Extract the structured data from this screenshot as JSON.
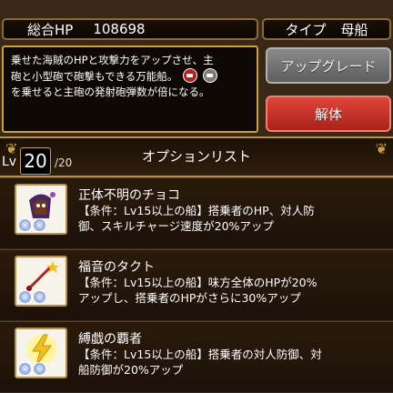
{
  "stats": {
    "hp_label": "総合HP",
    "hp_value": "108698",
    "type_label": "タイプ",
    "type_value": "母船"
  },
  "description": {
    "line1": "乗せた海賊のHPと攻撃力をアップさせ、主",
    "line2": "砲と小型砲で砲撃もできる万能船。",
    "line3": "を乗せると主砲の発射砲弾数が倍になる。",
    "icons": [
      "cannon-icon-red",
      "cannon-icon-gray"
    ]
  },
  "buttons": {
    "upgrade": "アップグレード",
    "release": "解体"
  },
  "level": {
    "label": "Lv",
    "current": "20",
    "max": "/20"
  },
  "options_title": "オプションリスト",
  "options": [
    {
      "name": "正体不明のチョコ",
      "desc1": "【条件：Lv15以上の船】搭乗者のHP、対人防",
      "desc2": "御、スキルチャージ速度が20%アップ",
      "icon": "chocolate-icon",
      "stars": [
        "☆",
        "☆"
      ]
    },
    {
      "name": "福音のタクト",
      "desc1": "【条件：Lv15以上の船】味方全体のHPが20%",
      "desc2": "アップし、搭乗者のHPがさらに30%アップ",
      "icon": "baton-icon",
      "stars": [
        "☆",
        "☆"
      ]
    },
    {
      "name": "縛戯の覇者",
      "desc1": "【条件：Lv15以上の船】搭乗者の対人防御、対",
      "desc2": "船防御が20%アップ",
      "icon": "lightning-icon",
      "stars": [
        "☆",
        "☆"
      ]
    }
  ],
  "colors": {
    "accent_gold": "#c8a040",
    "release_red": "#c8322a",
    "upgrade_gray": "#6e6e6e"
  }
}
